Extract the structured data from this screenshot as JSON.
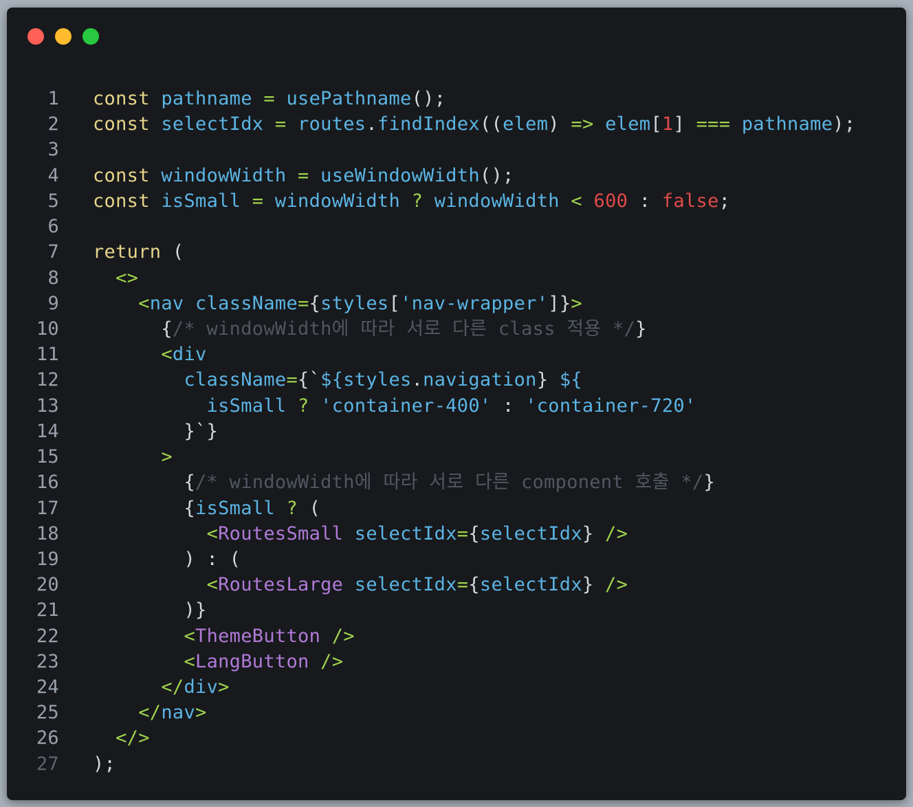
{
  "window": {
    "controls": [
      {
        "name": "close",
        "color": "#ff5f57"
      },
      {
        "name": "minimize",
        "color": "#febc2e"
      },
      {
        "name": "maximize",
        "color": "#28c840"
      }
    ]
  },
  "colors": {
    "keyword": "#e6d58a",
    "identifier": "#5bb4e4",
    "operator": "#a0d34e",
    "number": "#e04a4a",
    "string": "#5bb4e4",
    "comment": "#505760",
    "component": "#b07ad8",
    "punctuation": "#d5d8dc"
  },
  "code_lines": [
    {
      "n": "1",
      "tokens": [
        [
          "kw",
          "const"
        ],
        [
          "pl",
          " "
        ],
        [
          "var",
          "pathname"
        ],
        [
          "pl",
          " "
        ],
        [
          "op",
          "="
        ],
        [
          "pl",
          " "
        ],
        [
          "var",
          "usePathname"
        ],
        [
          "pl",
          "();"
        ]
      ]
    },
    {
      "n": "2",
      "tokens": [
        [
          "kw",
          "const"
        ],
        [
          "pl",
          " "
        ],
        [
          "var",
          "selectIdx"
        ],
        [
          "pl",
          " "
        ],
        [
          "op",
          "="
        ],
        [
          "pl",
          " "
        ],
        [
          "var",
          "routes"
        ],
        [
          "pl",
          "."
        ],
        [
          "var",
          "findIndex"
        ],
        [
          "pl",
          "(("
        ],
        [
          "var",
          "elem"
        ],
        [
          "pl",
          ") "
        ],
        [
          "op",
          "=>"
        ],
        [
          "pl",
          " "
        ],
        [
          "var",
          "elem"
        ],
        [
          "pl",
          "["
        ],
        [
          "num",
          "1"
        ],
        [
          "pl",
          "] "
        ],
        [
          "op",
          "==="
        ],
        [
          "pl",
          " "
        ],
        [
          "var",
          "pathname"
        ],
        [
          "pl",
          ");"
        ]
      ]
    },
    {
      "n": "3",
      "tokens": []
    },
    {
      "n": "4",
      "tokens": [
        [
          "kw",
          "const"
        ],
        [
          "pl",
          " "
        ],
        [
          "var",
          "windowWidth"
        ],
        [
          "pl",
          " "
        ],
        [
          "op",
          "="
        ],
        [
          "pl",
          " "
        ],
        [
          "var",
          "useWindowWidth"
        ],
        [
          "pl",
          "();"
        ]
      ]
    },
    {
      "n": "5",
      "tokens": [
        [
          "kw",
          "const"
        ],
        [
          "pl",
          " "
        ],
        [
          "var",
          "isSmall"
        ],
        [
          "pl",
          " "
        ],
        [
          "op",
          "="
        ],
        [
          "pl",
          " "
        ],
        [
          "var",
          "windowWidth"
        ],
        [
          "pl",
          " "
        ],
        [
          "op",
          "?"
        ],
        [
          "pl",
          " "
        ],
        [
          "var",
          "windowWidth"
        ],
        [
          "pl",
          " "
        ],
        [
          "op",
          "<"
        ],
        [
          "pl",
          " "
        ],
        [
          "num",
          "600"
        ],
        [
          "pl",
          " : "
        ],
        [
          "num",
          "false"
        ],
        [
          "pl",
          ";"
        ]
      ]
    },
    {
      "n": "6",
      "tokens": []
    },
    {
      "n": "7",
      "tokens": [
        [
          "kw",
          "return"
        ],
        [
          "pl",
          " ("
        ]
      ]
    },
    {
      "n": "8",
      "tokens": [
        [
          "pl",
          "  "
        ],
        [
          "op",
          "<>"
        ]
      ]
    },
    {
      "n": "9",
      "tokens": [
        [
          "pl",
          "    "
        ],
        [
          "op",
          "<"
        ],
        [
          "var",
          "nav"
        ],
        [
          "pl",
          " "
        ],
        [
          "var",
          "className"
        ],
        [
          "op",
          "="
        ],
        [
          "pl",
          "{"
        ],
        [
          "var",
          "styles"
        ],
        [
          "pl",
          "["
        ],
        [
          "str",
          "'nav-wrapper'"
        ],
        [
          "pl",
          "]}"
        ],
        [
          "op",
          ">"
        ]
      ]
    },
    {
      "n": "10",
      "tokens": [
        [
          "pl",
          "      {"
        ],
        [
          "cm",
          "/* windowWidth에 따라 서로 다른 class 적용 */"
        ],
        [
          "pl",
          "}"
        ]
      ]
    },
    {
      "n": "11",
      "tokens": [
        [
          "pl",
          "      "
        ],
        [
          "op",
          "<"
        ],
        [
          "var",
          "div"
        ]
      ]
    },
    {
      "n": "12",
      "tokens": [
        [
          "pl",
          "        "
        ],
        [
          "var",
          "className"
        ],
        [
          "op",
          "="
        ],
        [
          "pl",
          "{`"
        ],
        [
          "var",
          "${styles"
        ],
        [
          "pl",
          "."
        ],
        [
          "var",
          "navigation"
        ],
        [
          "pl",
          "} "
        ],
        [
          "var",
          "${"
        ]
      ]
    },
    {
      "n": "13",
      "tokens": [
        [
          "pl",
          "          "
        ],
        [
          "var",
          "isSmall"
        ],
        [
          "pl",
          " "
        ],
        [
          "op",
          "?"
        ],
        [
          "pl",
          " "
        ],
        [
          "str",
          "'container-400'"
        ],
        [
          "pl",
          " : "
        ],
        [
          "str",
          "'container-720'"
        ]
      ]
    },
    {
      "n": "14",
      "tokens": [
        [
          "pl",
          "        }`}"
        ]
      ]
    },
    {
      "n": "15",
      "tokens": [
        [
          "pl",
          "      "
        ],
        [
          "op",
          ">"
        ]
      ]
    },
    {
      "n": "16",
      "tokens": [
        [
          "pl",
          "        {"
        ],
        [
          "cm",
          "/* windowWidth에 따라 서로 다른 component 호출 */"
        ],
        [
          "pl",
          "}"
        ]
      ]
    },
    {
      "n": "17",
      "tokens": [
        [
          "pl",
          "        {"
        ],
        [
          "var",
          "isSmall"
        ],
        [
          "pl",
          " "
        ],
        [
          "op",
          "?"
        ],
        [
          "pl",
          " ("
        ]
      ]
    },
    {
      "n": "18",
      "tokens": [
        [
          "pl",
          "          "
        ],
        [
          "op",
          "<"
        ],
        [
          "tag",
          "RoutesSmall"
        ],
        [
          "pl",
          " "
        ],
        [
          "var",
          "selectIdx"
        ],
        [
          "op",
          "="
        ],
        [
          "pl",
          "{"
        ],
        [
          "var",
          "selectIdx"
        ],
        [
          "pl",
          "} "
        ],
        [
          "op",
          "/>"
        ]
      ]
    },
    {
      "n": "19",
      "tokens": [
        [
          "pl",
          "        ) : ("
        ]
      ]
    },
    {
      "n": "20",
      "tokens": [
        [
          "pl",
          "          "
        ],
        [
          "op",
          "<"
        ],
        [
          "tag",
          "RoutesLarge"
        ],
        [
          "pl",
          " "
        ],
        [
          "var",
          "selectIdx"
        ],
        [
          "op",
          "="
        ],
        [
          "pl",
          "{"
        ],
        [
          "var",
          "selectIdx"
        ],
        [
          "pl",
          "} "
        ],
        [
          "op",
          "/>"
        ]
      ]
    },
    {
      "n": "21",
      "tokens": [
        [
          "pl",
          "        )}"
        ]
      ]
    },
    {
      "n": "22",
      "tokens": [
        [
          "pl",
          "        "
        ],
        [
          "op",
          "<"
        ],
        [
          "tag",
          "ThemeButton"
        ],
        [
          "pl",
          " "
        ],
        [
          "op",
          "/>"
        ]
      ]
    },
    {
      "n": "23",
      "tokens": [
        [
          "pl",
          "        "
        ],
        [
          "op",
          "<"
        ],
        [
          "tag",
          "LangButton"
        ],
        [
          "pl",
          " "
        ],
        [
          "op",
          "/>"
        ]
      ]
    },
    {
      "n": "24",
      "tokens": [
        [
          "pl",
          "      "
        ],
        [
          "op",
          "</"
        ],
        [
          "var",
          "div"
        ],
        [
          "op",
          ">"
        ]
      ]
    },
    {
      "n": "25",
      "tokens": [
        [
          "pl",
          "    "
        ],
        [
          "op",
          "</"
        ],
        [
          "var",
          "nav"
        ],
        [
          "op",
          ">"
        ]
      ]
    },
    {
      "n": "26",
      "tokens": [
        [
          "pl",
          "  "
        ],
        [
          "op",
          "</>"
        ]
      ]
    },
    {
      "n": "27",
      "dim": true,
      "tokens": [
        [
          "pl",
          ");"
        ]
      ]
    }
  ]
}
